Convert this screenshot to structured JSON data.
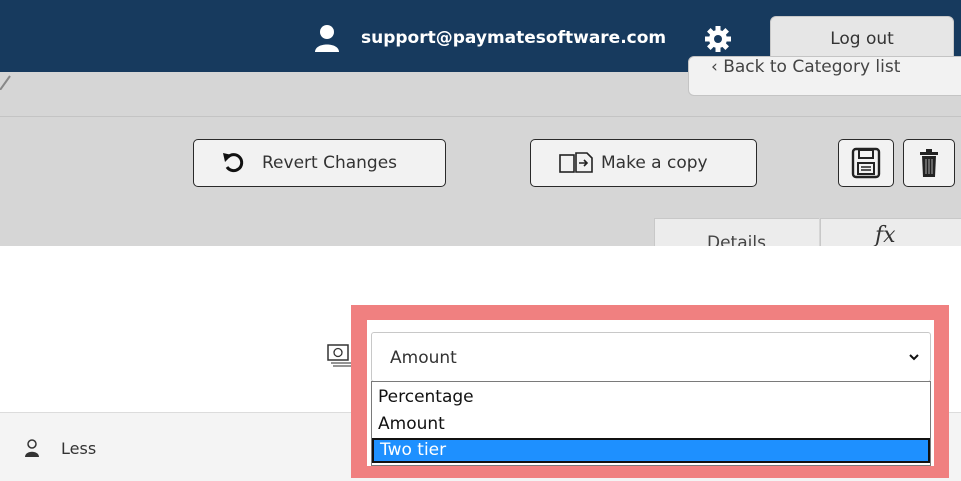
{
  "header": {
    "email": "support@paymatesoftware.com",
    "logout_label": "Log out",
    "user_icon": "user-icon",
    "settings_icon": "gear-icon"
  },
  "nav": {
    "back_label": "Back to Category list"
  },
  "toolbar": {
    "revert_label": "Revert Changes",
    "copy_label": "Make a copy",
    "save_icon": "save-icon",
    "delete_icon": "trash-icon"
  },
  "tabs": [
    {
      "label": "Details"
    },
    {
      "label": "fx"
    }
  ],
  "form": {
    "type_icon": "money-icon",
    "selected_value": "Amount",
    "options": [
      "Percentage",
      "Amount",
      "Two tier"
    ],
    "highlighted_option": "Two tier"
  },
  "footer": {
    "less_label": "Less"
  },
  "colors": {
    "header_bg": "#173a5e",
    "highlight": "#f08080",
    "selected_option": "#1e90ff"
  }
}
